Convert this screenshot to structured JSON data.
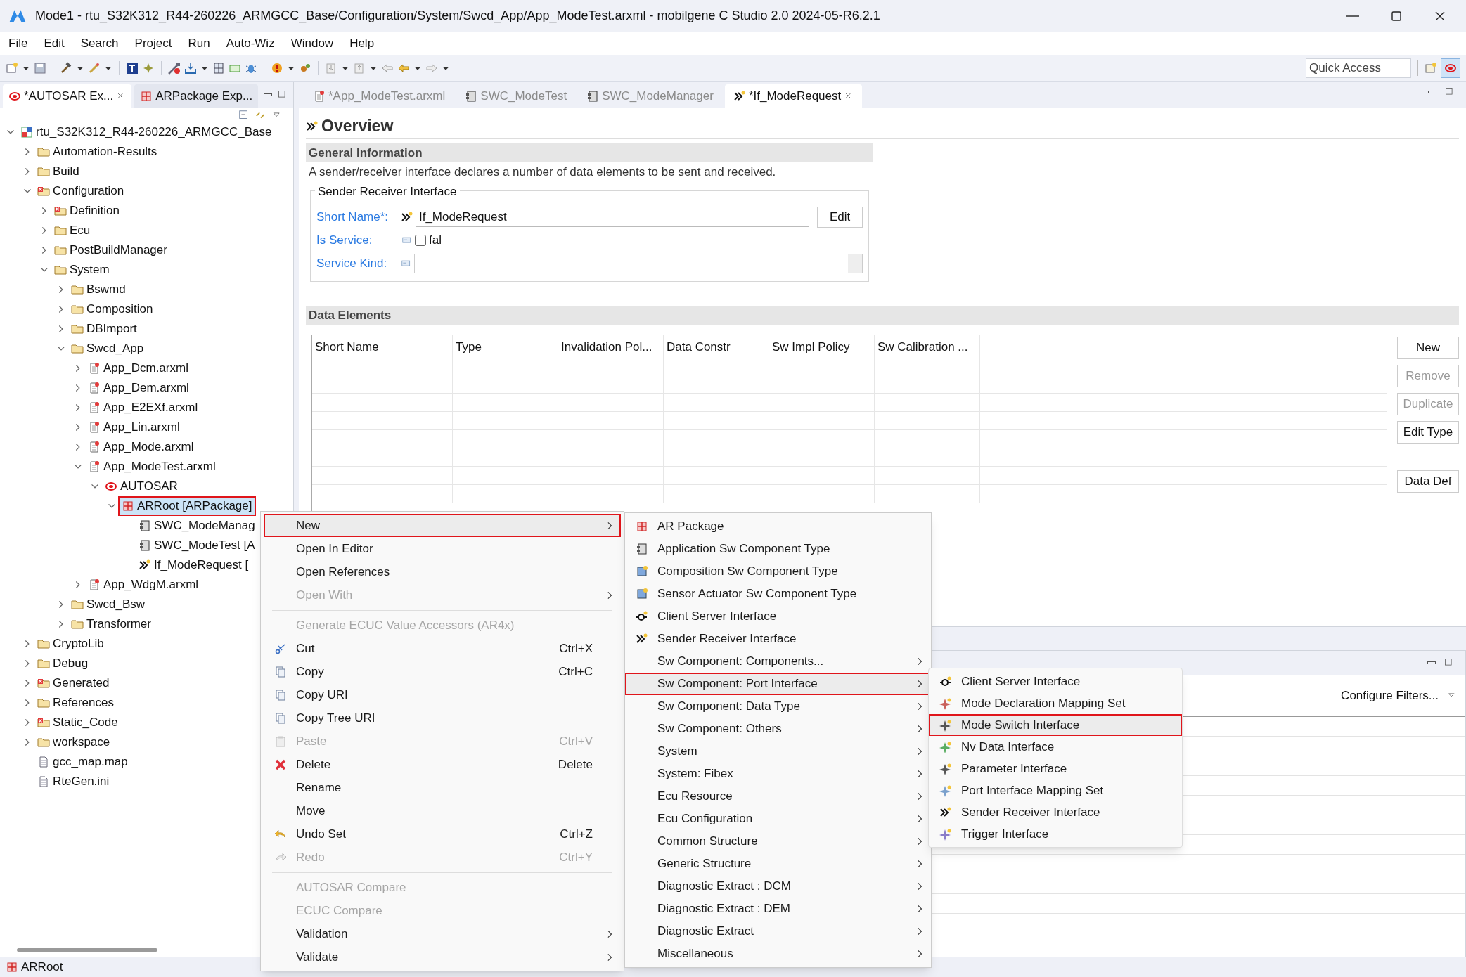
{
  "window": {
    "title": "Mode1 - rtu_S32K312_R44-260226_ARMGCC_Base/Configuration/System/Swcd_App/App_ModeTest.arxml - mobilgene C Studio 2.0 2024-05-R6.2.1"
  },
  "menu_bar": [
    "File",
    "Edit",
    "Search",
    "Project",
    "Run",
    "Auto-Wiz",
    "Window",
    "Help"
  ],
  "quick_access": {
    "placeholder": "Quick Access"
  },
  "left_tabs": [
    {
      "label": "*AUTOSAR Ex...",
      "selected": true
    },
    {
      "label": "ARPackage Exp...",
      "selected": false
    }
  ],
  "tree": [
    {
      "label": "rtu_S32K312_R44-260226_ARMGCC_Base",
      "kind": "project",
      "expanded": true,
      "selected": false,
      "children": [
        {
          "label": "Automation-Results",
          "kind": "folder",
          "expanded": false,
          "selected": false
        },
        {
          "label": "Build",
          "kind": "folder",
          "expanded": false,
          "selected": false
        },
        {
          "label": "Configuration",
          "kind": "config-folder",
          "expanded": true,
          "selected": false,
          "children": [
            {
              "label": "Definition",
              "kind": "config-folder",
              "expanded": false,
              "selected": false
            },
            {
              "label": "Ecu",
              "kind": "folder",
              "expanded": false,
              "selected": false
            },
            {
              "label": "PostBuildManager",
              "kind": "folder",
              "expanded": false,
              "selected": false
            },
            {
              "label": "System",
              "kind": "folder",
              "expanded": true,
              "selected": false,
              "children": [
                {
                  "label": "Bswmd",
                  "kind": "folder",
                  "expanded": false,
                  "selected": false
                },
                {
                  "label": "Composition",
                  "kind": "folder",
                  "expanded": false,
                  "selected": false
                },
                {
                  "label": "DBImport",
                  "kind": "folder",
                  "expanded": false,
                  "selected": false
                },
                {
                  "label": "Swcd_App",
                  "kind": "folder",
                  "expanded": true,
                  "selected": false,
                  "children": [
                    {
                      "label": "App_Dcm.arxml",
                      "kind": "arxml",
                      "expanded": false,
                      "selected": false
                    },
                    {
                      "label": "App_Dem.arxml",
                      "kind": "arxml",
                      "expanded": false,
                      "selected": false
                    },
                    {
                      "label": "App_E2EXf.arxml",
                      "kind": "arxml",
                      "expanded": false,
                      "selected": false
                    },
                    {
                      "label": "App_Lin.arxml",
                      "kind": "arxml",
                      "expanded": false,
                      "selected": false
                    },
                    {
                      "label": "App_Mode.arxml",
                      "kind": "arxml",
                      "expanded": false,
                      "selected": false
                    },
                    {
                      "label": "App_ModeTest.arxml",
                      "kind": "arxml",
                      "expanded": true,
                      "selected": false,
                      "children": [
                        {
                          "label": "AUTOSAR",
                          "kind": "autosar",
                          "expanded": true,
                          "selected": false,
                          "children": [
                            {
                              "label": "ARRoot [ARPackage]",
                              "kind": "package",
                              "expanded": true,
                              "selected": true,
                              "children": [
                                {
                                  "label": "SWC_ModeManag",
                                  "kind": "component",
                                  "selected": false
                                },
                                {
                                  "label": "SWC_ModeTest [A",
                                  "kind": "component",
                                  "selected": false
                                },
                                {
                                  "label": "If_ModeRequest [",
                                  "kind": "interface",
                                  "selected": false
                                }
                              ]
                            }
                          ]
                        }
                      ]
                    },
                    {
                      "label": "App_WdgM.arxml",
                      "kind": "arxml",
                      "expanded": false,
                      "selected": false
                    }
                  ]
                },
                {
                  "label": "Swcd_Bsw",
                  "kind": "folder",
                  "expanded": false,
                  "selected": false
                },
                {
                  "label": "Transformer",
                  "kind": "folder",
                  "expanded": false,
                  "selected": false
                }
              ]
            }
          ]
        },
        {
          "label": "CryptoLib",
          "kind": "folder",
          "expanded": false,
          "selected": false
        },
        {
          "label": "Debug",
          "kind": "folder",
          "expanded": false,
          "selected": false
        },
        {
          "label": "Generated",
          "kind": "config-folder",
          "expanded": false,
          "selected": false
        },
        {
          "label": "References",
          "kind": "folder",
          "expanded": false,
          "selected": false
        },
        {
          "label": "Static_Code",
          "kind": "config-folder",
          "expanded": false,
          "selected": false
        },
        {
          "label": "workspace",
          "kind": "folder",
          "expanded": false,
          "selected": false
        },
        {
          "label": "gcc_map.map",
          "kind": "file",
          "selected": false
        },
        {
          "label": "RteGen.ini",
          "kind": "file",
          "selected": false
        }
      ]
    }
  ],
  "editor_tabs": [
    {
      "label": "*App_ModeTest.arxml",
      "selected": false
    },
    {
      "label": "SWC_ModeTest",
      "selected": false
    },
    {
      "label": "SWC_ModeManager",
      "selected": false
    },
    {
      "label": "*If_ModeRequest",
      "selected": true
    }
  ],
  "overview": {
    "title": "Overview",
    "general_information": {
      "heading": "General Information",
      "description": "A sender/receiver interface declares a number of data elements to be sent and received.",
      "group_title": "Sender Receiver Interface",
      "short_name": {
        "label": "Short Name*:",
        "value": "If_ModeRequest",
        "button": "Edit"
      },
      "is_service": {
        "label": "Is Service:",
        "checked": false,
        "value": "fal"
      },
      "service_kind": {
        "label": "Service Kind:"
      }
    },
    "data_elements": {
      "heading": "Data Elements",
      "columns": [
        "Short Name",
        "Type",
        "Invalidation Pol...",
        "Data Constr",
        "Sw Impl Policy",
        "Sw Calibration ..."
      ],
      "buttons": [
        {
          "label": "New",
          "disabled": false
        },
        {
          "label": "Remove",
          "disabled": true
        },
        {
          "label": "Duplicate",
          "disabled": true
        },
        {
          "label": "Edit Type",
          "disabled": false
        },
        {
          "label": "Data Def",
          "disabled": false
        }
      ]
    }
  },
  "lower_panel": {
    "filter_button": "Configure Filters..."
  },
  "context_menu": [
    {
      "kind": "item",
      "label": "New",
      "has_submenu": true,
      "disabled": false,
      "selected": true
    },
    {
      "kind": "item",
      "label": "Open In Editor",
      "has_submenu": false,
      "disabled": false,
      "selected": false
    },
    {
      "kind": "item",
      "label": "Open References",
      "has_submenu": false,
      "disabled": false,
      "selected": false
    },
    {
      "kind": "item",
      "label": "Open With",
      "has_submenu": true,
      "disabled": true,
      "selected": false
    },
    {
      "kind": "separator"
    },
    {
      "kind": "item",
      "label": "Generate ECUC Value Accessors (AR4x)",
      "has_submenu": false,
      "disabled": true,
      "selected": false
    },
    {
      "kind": "item",
      "label": "Cut",
      "shortcut": "Ctrl+X",
      "has_submenu": false,
      "disabled": false,
      "selected": false
    },
    {
      "kind": "item",
      "label": "Copy",
      "shortcut": "Ctrl+C",
      "has_submenu": false,
      "disabled": false,
      "selected": false
    },
    {
      "kind": "item",
      "label": "Copy URI",
      "has_submenu": false,
      "disabled": false,
      "selected": false
    },
    {
      "kind": "item",
      "label": "Copy Tree URI",
      "has_submenu": false,
      "disabled": false,
      "selected": false
    },
    {
      "kind": "item",
      "label": "Paste",
      "shortcut": "Ctrl+V",
      "has_submenu": false,
      "disabled": true,
      "selected": false
    },
    {
      "kind": "item",
      "label": "Delete",
      "shortcut": "Delete",
      "has_submenu": false,
      "disabled": false,
      "selected": false
    },
    {
      "kind": "item",
      "label": "Rename",
      "has_submenu": false,
      "disabled": false,
      "selected": false
    },
    {
      "kind": "item",
      "label": "Move",
      "has_submenu": false,
      "disabled": false,
      "selected": false
    },
    {
      "kind": "item",
      "label": "Undo Set",
      "shortcut": "Ctrl+Z",
      "has_submenu": false,
      "disabled": false,
      "selected": false
    },
    {
      "kind": "item",
      "label": "Redo",
      "shortcut": "Ctrl+Y",
      "has_submenu": false,
      "disabled": true,
      "selected": false
    },
    {
      "kind": "separator"
    },
    {
      "kind": "item",
      "label": "AUTOSAR Compare",
      "has_submenu": false,
      "disabled": true,
      "selected": false
    },
    {
      "kind": "item",
      "label": "ECUC Compare",
      "has_submenu": false,
      "disabled": true,
      "selected": false
    },
    {
      "kind": "item",
      "label": "Validation",
      "has_submenu": true,
      "disabled": false,
      "selected": false
    },
    {
      "kind": "item",
      "label": "Validate",
      "has_submenu": true,
      "disabled": false,
      "selected": false
    }
  ],
  "new_submenu": [
    {
      "label": "AR Package",
      "has_submenu": false,
      "selected": false
    },
    {
      "label": "Application Sw Component Type",
      "has_submenu": false,
      "selected": false
    },
    {
      "label": "Composition Sw Component Type",
      "has_submenu": false,
      "selected": false
    },
    {
      "label": "Sensor Actuator Sw Component Type",
      "has_submenu": false,
      "selected": false
    },
    {
      "label": "Client Server Interface",
      "has_submenu": false,
      "selected": false
    },
    {
      "label": "Sender Receiver Interface",
      "has_submenu": false,
      "selected": false
    },
    {
      "label": "Sw Component: Components...",
      "has_submenu": true,
      "selected": false
    },
    {
      "label": "Sw Component: Port Interface",
      "has_submenu": true,
      "selected": true
    },
    {
      "label": "Sw Component: Data Type",
      "has_submenu": true,
      "selected": false
    },
    {
      "label": "Sw Component: Others",
      "has_submenu": true,
      "selected": false
    },
    {
      "label": "System",
      "has_submenu": true,
      "selected": false
    },
    {
      "label": "System: Fibex",
      "has_submenu": true,
      "selected": false
    },
    {
      "label": "Ecu Resource",
      "has_submenu": true,
      "selected": false
    },
    {
      "label": "Ecu Configuration",
      "has_submenu": true,
      "selected": false
    },
    {
      "label": "Common Structure",
      "has_submenu": true,
      "selected": false
    },
    {
      "label": "Generic Structure",
      "has_submenu": true,
      "selected": false
    },
    {
      "label": "Diagnostic Extract : DCM",
      "has_submenu": true,
      "selected": false
    },
    {
      "label": "Diagnostic Extract : DEM",
      "has_submenu": true,
      "selected": false
    },
    {
      "label": "Diagnostic Extract",
      "has_submenu": true,
      "selected": false
    },
    {
      "label": "Miscellaneous",
      "has_submenu": true,
      "selected": false
    }
  ],
  "port_interface_submenu": [
    {
      "label": "Client Server Interface",
      "selected": false
    },
    {
      "label": "Mode Declaration Mapping Set",
      "selected": false
    },
    {
      "label": "Mode Switch Interface",
      "selected": true
    },
    {
      "label": "Nv Data Interface",
      "selected": false
    },
    {
      "label": "Parameter Interface",
      "selected": false
    },
    {
      "label": "Port Interface Mapping Set",
      "selected": false
    },
    {
      "label": "Sender Receiver Interface",
      "selected": false
    },
    {
      "label": "Trigger Interface",
      "selected": false
    }
  ],
  "status_bar": {
    "text": "ARRoot"
  }
}
